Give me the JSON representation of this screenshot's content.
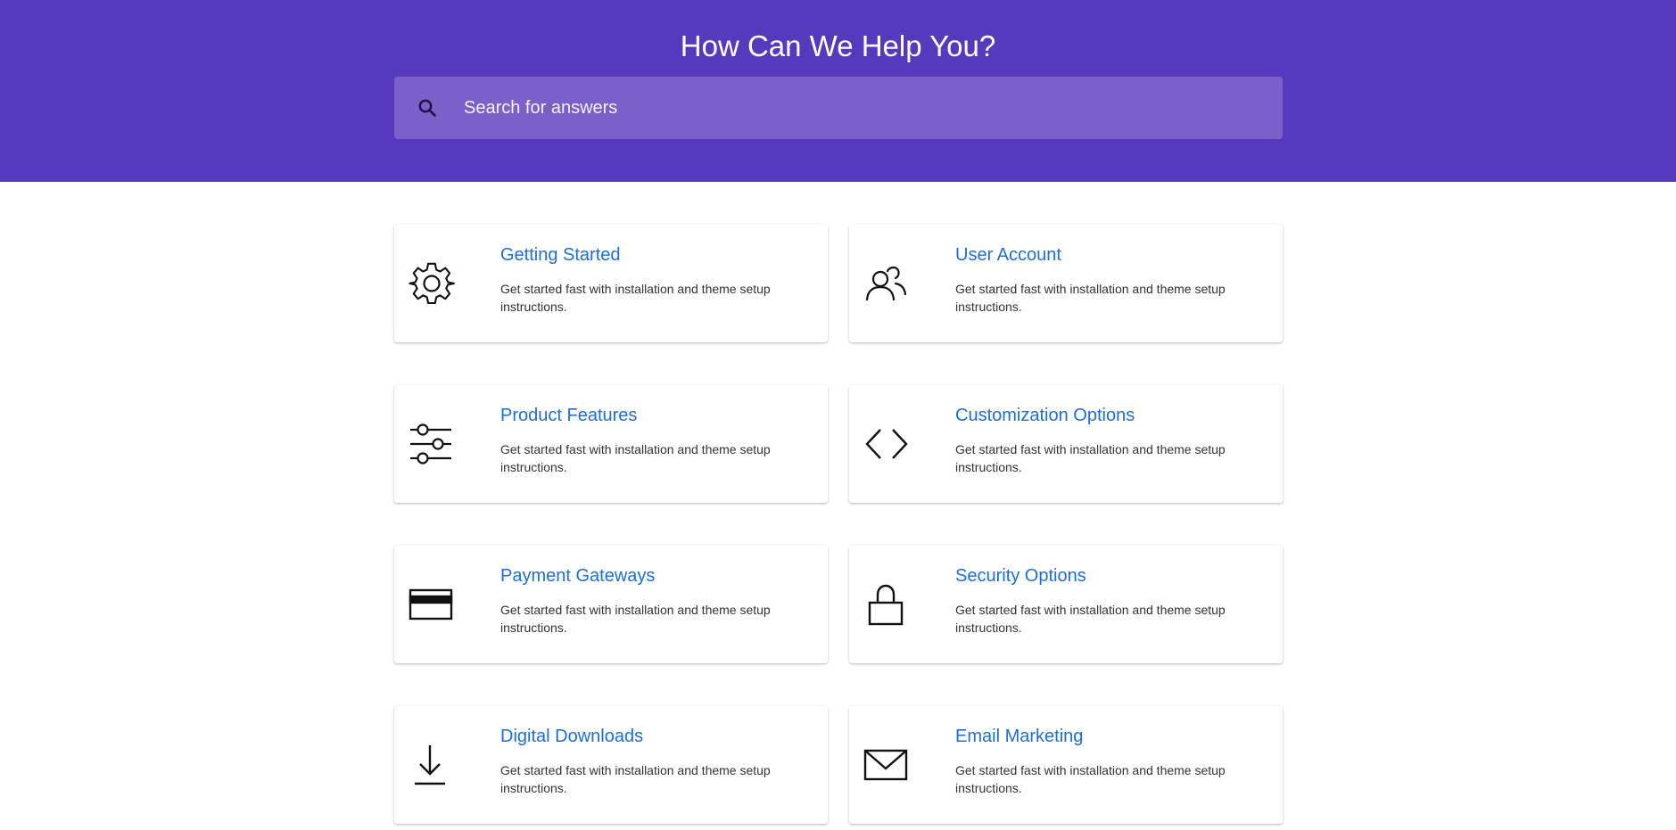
{
  "header": {
    "title": "How Can We Help You?",
    "background_color": "#5639bd",
    "search": {
      "icon": "search-icon",
      "placeholder": "Search for answers",
      "value": ""
    }
  },
  "categories": [
    {
      "title": "Getting Started",
      "description": "Get started fast with installation and theme setup instructions.",
      "icon": "gear-icon"
    },
    {
      "title": "User Account",
      "description": "Get started fast with installation and theme setup instructions.",
      "icon": "users-icon"
    },
    {
      "title": "Product Features",
      "description": "Get started fast with installation and theme setup instructions.",
      "icon": "sliders-icon"
    },
    {
      "title": "Customization Options",
      "description": "Get started fast with installation and theme setup instructions.",
      "icon": "code-icon"
    },
    {
      "title": "Payment Gateways",
      "description": "Get started fast with installation and theme setup instructions.",
      "icon": "credit-card-icon"
    },
    {
      "title": "Security Options",
      "description": "Get started fast with installation and theme setup instructions.",
      "icon": "lock-icon"
    },
    {
      "title": "Digital Downloads",
      "description": "Get started fast with installation and theme setup instructions.",
      "icon": "download-icon"
    },
    {
      "title": "Email Marketing",
      "description": "Get started fast with installation and theme setup instructions.",
      "icon": "envelope-icon"
    }
  ],
  "colors": {
    "accent": "#1a6fdb",
    "search_bar": "#7a60c8"
  }
}
